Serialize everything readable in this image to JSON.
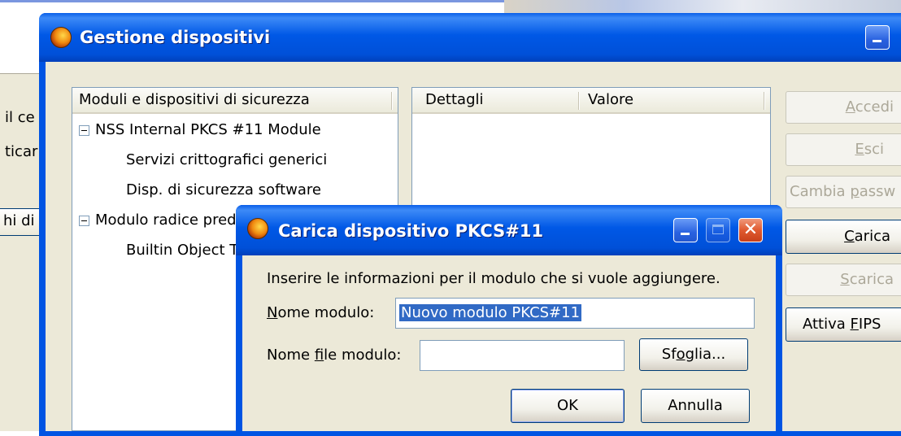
{
  "background": {
    "fragments": [
      "il ce",
      "ticar",
      "hi di"
    ]
  },
  "main_dialog": {
    "title": "Gestione dispositivi",
    "tree": {
      "header": "Moduli e dispositivi di sicurezza",
      "items": [
        {
          "label": "NSS Internal PKCS #11 Module",
          "level": 0,
          "expander": "minus"
        },
        {
          "label": "Servizi crittografici generici",
          "level": 1
        },
        {
          "label": "Disp. di sicurezza software",
          "level": 1
        },
        {
          "label": "Modulo radice pred",
          "level": 0,
          "expander": "minus"
        },
        {
          "label": "Builtin Object T",
          "level": 1
        }
      ]
    },
    "details": {
      "col_details": "Dettagli",
      "col_value": "Valore"
    },
    "buttons": {
      "accedi": {
        "pre": "",
        "key": "A",
        "post": "ccedi",
        "enabled": false
      },
      "esci": {
        "pre": "",
        "key": "E",
        "post": "sci",
        "enabled": false
      },
      "cambia": {
        "pre": "Cambia ",
        "key": "p",
        "post": "assw",
        "enabled": false
      },
      "carica": {
        "pre": "",
        "key": "C",
        "post": "arica",
        "enabled": true
      },
      "scarica": {
        "pre": "",
        "key": "S",
        "post": "carica",
        "enabled": false
      },
      "fips": {
        "pre": "Attiva ",
        "key": "F",
        "post": "IPS",
        "enabled": true
      }
    }
  },
  "load_dialog": {
    "title": "Carica dispositivo PKCS#11",
    "instruction": "Inserire le informazioni per il modulo che si vuole aggiungere.",
    "module_name": {
      "pre": "",
      "key": "N",
      "post": "ome modulo:",
      "value": "Nuovo modulo PKCS#11"
    },
    "module_file": {
      "pre": "Nome ",
      "key": "f",
      "post": "ile modulo:",
      "value": ""
    },
    "browse": {
      "pre": "Sf",
      "key": "o",
      "post": "glia..."
    },
    "ok": "OK",
    "cancel": "Annulla"
  },
  "colors": {
    "title_bar": "#0054e3",
    "dialog_face": "#ece9d8",
    "selection": "#316ac5",
    "close_button": "#e05a30"
  },
  "icons": [
    "firefox-icon",
    "minimize-icon",
    "maximize-icon",
    "close-icon",
    "tree-collapse-icon"
  ]
}
